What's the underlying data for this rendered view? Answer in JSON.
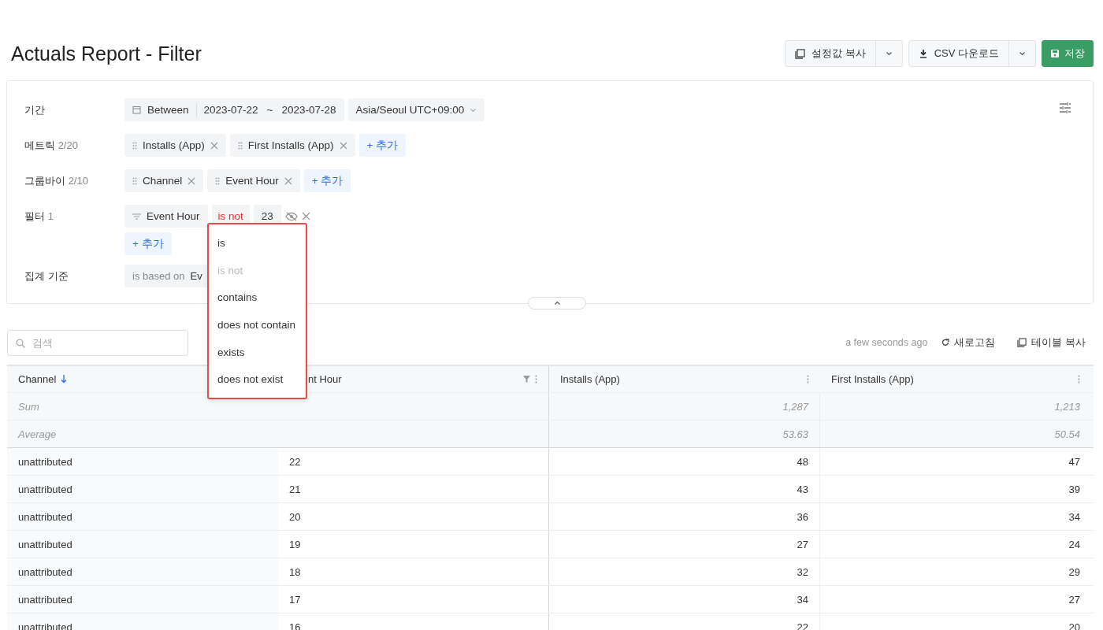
{
  "title": "Actuals Report - Filter",
  "header_buttons": [
    {
      "kind": "copy",
      "label": "설정값 복사",
      "has_menu": true
    },
    {
      "kind": "download",
      "label": "CSV 다운로드",
      "has_menu": true
    },
    {
      "kind": "save",
      "label": "저장",
      "has_menu": false
    }
  ],
  "filters": {
    "period": {
      "label": "기간",
      "mode": "Between",
      "start": "2023-07-22",
      "separator": "~",
      "end": "2023-07-28",
      "timezone": "Asia/Seoul UTC+09:00"
    },
    "metrics": {
      "label": "메트릭",
      "count": "2/20",
      "items": [
        "Installs (App)",
        "First Installs (App)"
      ],
      "add": "+ 추가"
    },
    "groupby": {
      "label": "그룹바이",
      "count": "2/10",
      "items": [
        "Channel",
        "Event Hour"
      ],
      "add": "+ 추가"
    },
    "filter": {
      "label": "필터",
      "count": "1",
      "field": "Event Hour",
      "operator": "is not",
      "value": "23",
      "add": "+ 추가"
    },
    "basis": {
      "label": "집계 기준",
      "prefix": "is based on",
      "value": "Ev"
    }
  },
  "operator_menu": [
    {
      "label": "is",
      "selected": false
    },
    {
      "label": "is not",
      "selected": true
    },
    {
      "label": "contains",
      "selected": false
    },
    {
      "label": "does not contain",
      "selected": false
    },
    {
      "label": "exists",
      "selected": false
    },
    {
      "label": "does not exist",
      "selected": false
    }
  ],
  "search": {
    "placeholder": "검색"
  },
  "toolbar": {
    "updated": "a few seconds ago",
    "refresh": "새로고침",
    "copy_table": "테이블 복사"
  },
  "table": {
    "columns": [
      {
        "label": "Channel",
        "sorted": true
      },
      {
        "label": "nt Hour",
        "sorted": false
      },
      {
        "label": "Installs (App)",
        "sorted": false
      },
      {
        "label": "First Installs (App)",
        "sorted": false
      }
    ],
    "summary": [
      {
        "label": "Sum",
        "installs": "1,287",
        "first_installs": "1,213"
      },
      {
        "label": "Average",
        "installs": "53.63",
        "first_installs": "50.54"
      }
    ],
    "rows": [
      [
        "unattributed",
        "22",
        "48",
        "47"
      ],
      [
        "unattributed",
        "21",
        "43",
        "39"
      ],
      [
        "unattributed",
        "20",
        "36",
        "34"
      ],
      [
        "unattributed",
        "19",
        "27",
        "24"
      ],
      [
        "unattributed",
        "18",
        "32",
        "29"
      ],
      [
        "unattributed",
        "17",
        "34",
        "27"
      ],
      [
        "unattributed",
        "16",
        "22",
        "20"
      ]
    ]
  }
}
